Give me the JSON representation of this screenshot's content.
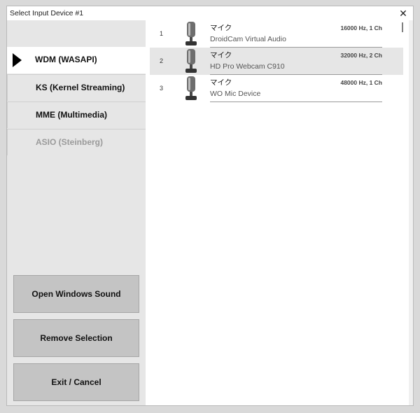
{
  "window": {
    "title": "Select Input Device #1",
    "close_icon": "close-icon"
  },
  "api_list": [
    {
      "label": "WDM (WASAPI)",
      "selected": true,
      "enabled": true
    },
    {
      "label": "KS (Kernel Streaming)",
      "selected": false,
      "enabled": true
    },
    {
      "label": "MME (Multimedia)",
      "selected": false,
      "enabled": true
    },
    {
      "label": "ASIO (Steinberg)",
      "selected": false,
      "enabled": false
    }
  ],
  "buttons": {
    "open_sound": "Open Windows Sound",
    "remove_selection": "Remove Selection",
    "exit_cancel": "Exit / Cancel"
  },
  "devices": [
    {
      "index": "1",
      "type": "マイク",
      "name": "DroidCam Virtual Audio",
      "format": "16000 Hz, 1 Ch",
      "selected": false,
      "icon": "microphone-icon"
    },
    {
      "index": "2",
      "type": "マイク",
      "name": "HD Pro Webcam C910",
      "format": "32000 Hz, 2 Ch",
      "selected": true,
      "icon": "microphone-icon"
    },
    {
      "index": "3",
      "type": "マイク",
      "name": "WO Mic Device",
      "format": "48000 Hz, 1 Ch",
      "selected": false,
      "icon": "microphone-icon"
    }
  ],
  "colors": {
    "selected_row": "#e6e6e6",
    "panel_bg": "#e6e6e6",
    "button_bg": "#c4c4c4"
  }
}
